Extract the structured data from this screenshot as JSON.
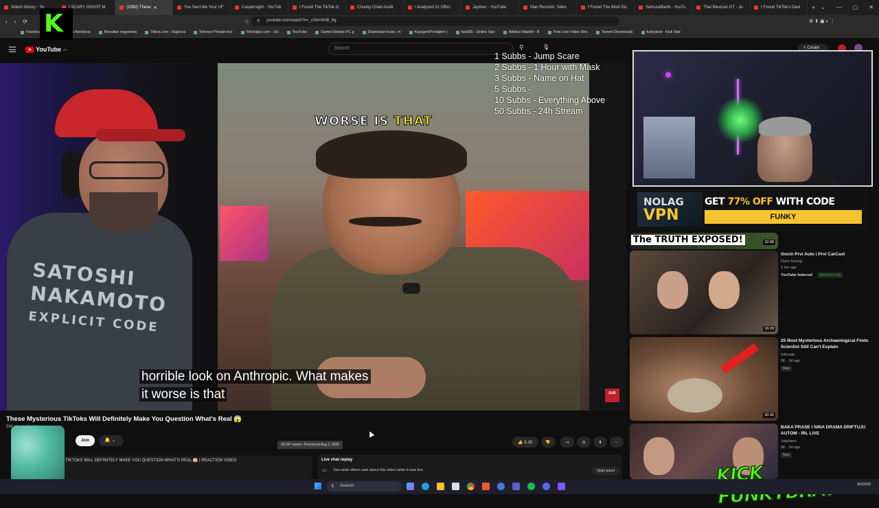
{
  "browser": {
    "tabs": [
      {
        "label": "Watch history - Yo",
        "active": false
      },
      {
        "label": "I SCARY GHOST M",
        "active": false
      },
      {
        "label": "(2392) These",
        "active": true
      },
      {
        "label": "You Sent Me Your UF",
        "active": false
      },
      {
        "label": "Caspersight - YouTub",
        "active": false
      },
      {
        "label": "I Found The TikTok O",
        "active": false
      },
      {
        "label": "Chunky Chalo Audit",
        "active": false
      },
      {
        "label": "I Analyzed 31 Offici",
        "active": false
      },
      {
        "label": "Jaymez - YouTube",
        "active": false
      },
      {
        "label": "Man Records \"Alien",
        "active": false
      },
      {
        "label": "I Found The Most Dis",
        "active": false
      },
      {
        "label": "SamuraiBarbi - YouTu",
        "active": false
      },
      {
        "label": "That Mexican OT - Ju",
        "active": false
      },
      {
        "label": "I Found TikTok's Dark",
        "active": false
      }
    ],
    "url": "youtube.com/watch?v=_cOeH4AB_8g",
    "bookmarks": [
      "Facebook",
      "Pokloni na Nordstop",
      "Rezultati nogometa",
      "Titlovi.com - Najveća",
      "Telemor Privatni kor",
      "FileHippo.com - Do",
      "YouTube",
      "Game-Debate PC g",
      "Download music, m",
      "KupujemProdajem |",
      "bet365 - Online Spo",
      "Atletico Madrid - B",
      "Free Live Video Stre",
      "Torrent Downloads",
      "funkybrat - Kick Stat"
    ]
  },
  "youtube": {
    "logo": "YouTube",
    "country": "RS",
    "search_placeholder": "Search",
    "create_label": "Create",
    "video_title": "These Mysterious TikToks Will Definitely Make You Question What's Real 😱",
    "views_line": "59K views  3d ago",
    "join_label": "Join",
    "likes": "5.1K",
    "tooltip": "59,047 views • Premiered Aug 2, 2026",
    "description": "TIKTOKS WILL DEFINITELY MAKE YOU QUESTION WHAT'S REAL 😱 | REACTION VIDEO",
    "chat_title": "Live chat replay",
    "chat_sub": "See what others said about this video while it was live.",
    "open_panel": "Open panel"
  },
  "video": {
    "caption_top_a": "WORSE IS",
    "caption_top_b": "THAT",
    "subtitle_line1": "horrible look on Anthropic. What makes",
    "subtitle_line2": "it worse is that",
    "shirt_line1": "SATOSHI",
    "shirt_line2": "NAKAMOTO",
    "shirt_line3": "EXPLICIT CODE",
    "sub_badge": "SUB"
  },
  "overlay": {
    "sub_goals": [
      "1 Subbs - Jump Scare",
      "2 Subbs - 1 Hour with Mask",
      "3 Subbs - Name on Hat",
      "5 Subbs -",
      "10 Subbs - Everything Above",
      "50 Subbs - 24h Stream"
    ],
    "kick_brand": "KICK FUNKYBRAT",
    "kick_logo_letter": "K"
  },
  "ad": {
    "brand_a": "NOLAG",
    "brand_b": "VPN",
    "headline_a": "GET",
    "headline_b": "77% OFF",
    "headline_c": "WITH CODE",
    "code": "FUNKY"
  },
  "sidebar_videos": [
    {
      "thumb_text": "The TRUTH EXPOSED!",
      "duration": "32:08",
      "title": "",
      "channel": "",
      "meta": "",
      "badge": ""
    },
    {
      "title": "Gocin Prvi Auto i Prvi CarCast",
      "channel": "Dario Kesogi",
      "meta": "1 mo ago",
      "badge": "YouTube featured",
      "member": "Members only",
      "duration": "18:28"
    },
    {
      "title": "25 Most Mysterious Archaeological Finds Scientist Still Can't Explain",
      "channel": "Inforado",
      "meta": "3K · 3d ago",
      "badge": "New",
      "duration": "30:36"
    },
    {
      "title": "BAKA PRASE I NINA DRAMA DRIFTUJU AUTOM - IRL LIVE",
      "channel": "Jutjubero",
      "meta": "6K · 3d ago",
      "badge": "New",
      "duration": ""
    }
  ],
  "taskbar": {
    "search": "Search",
    "time": "",
    "date": "8/6/2026"
  },
  "colors": {
    "accent": "#ff0000",
    "kick_green": "#53fc18",
    "ad_yellow": "#f5c430"
  }
}
